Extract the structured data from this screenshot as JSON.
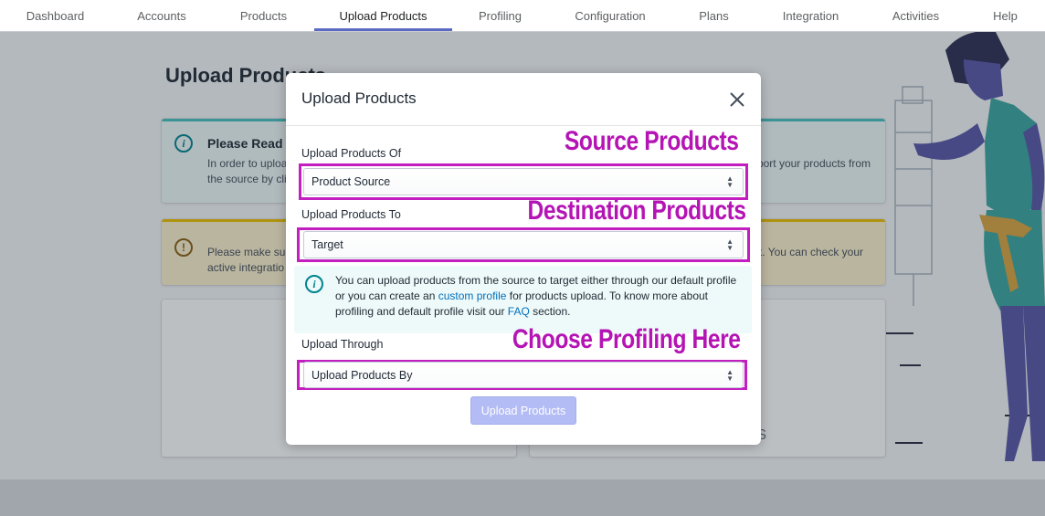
{
  "nav": {
    "tabs": [
      {
        "label": "Dashboard"
      },
      {
        "label": "Accounts"
      },
      {
        "label": "Products"
      },
      {
        "label": "Upload Products"
      },
      {
        "label": "Profiling"
      },
      {
        "label": "Configuration"
      },
      {
        "label": "Plans"
      },
      {
        "label": "Integration"
      },
      {
        "label": "Activities"
      },
      {
        "label": "Help"
      }
    ],
    "active_index": 3,
    "accent_color": "#5c6ac4"
  },
  "page": {
    "title": "Upload Products",
    "info_banner": {
      "title": "Please Read",
      "line1": "In order to uploa",
      "line2": "the source by cli",
      "line1_right": "port your products from"
    },
    "warn_banner": {
      "line1": "Please make sur",
      "line2": "active integratio",
      "line1_right": "t. You can check your"
    },
    "card_right_text": "S"
  },
  "modal": {
    "title": "Upload Products",
    "close_icon": "close-icon",
    "fields": {
      "source": {
        "label": "Upload Products Of",
        "value": "Product Source"
      },
      "target": {
        "label": "Upload Products To",
        "value": "Target"
      },
      "profile": {
        "label": "Upload Through",
        "value": "Upload Products By"
      }
    },
    "info": {
      "text_before": "You can upload products from the source to target either through our default profile or you can create an ",
      "link1": "custom profile",
      "text_middle": " for products upload. To know more about profiling and default profile visit our ",
      "link2": "FAQ",
      "text_after": " section."
    },
    "submit_label": "Upload Products"
  },
  "annotations": {
    "source": "Source Products",
    "destination": "Destination Products",
    "profiling": "Choose Profiling Here",
    "color": "#c21ec0"
  }
}
